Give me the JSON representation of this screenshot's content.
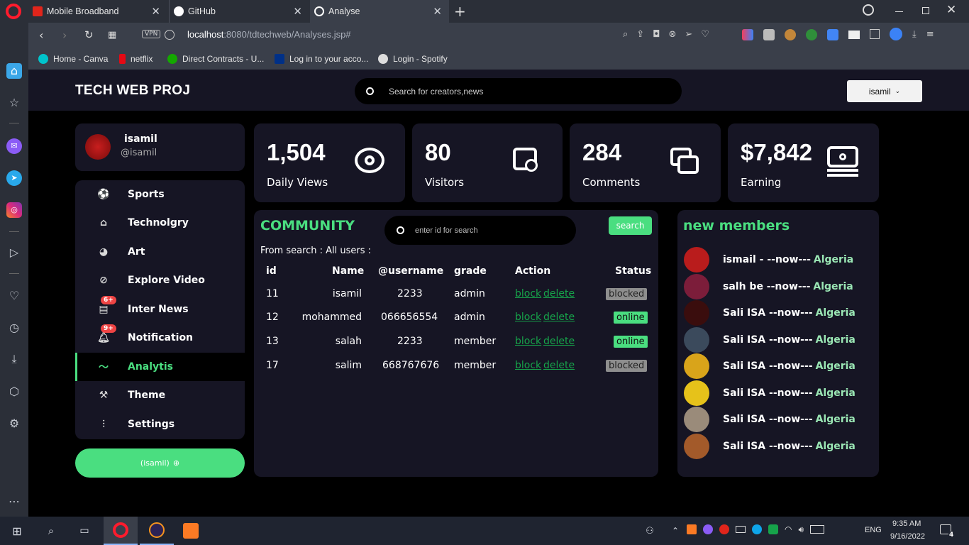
{
  "browser": {
    "tabs": [
      {
        "label": "Mobile Broadband",
        "favicon": "huawei-icon",
        "color": "#e1251b"
      },
      {
        "label": "GitHub",
        "favicon": "github-icon",
        "color": "#ffffff"
      },
      {
        "label": "Analyse",
        "favicon": "globe-icon",
        "color": "#ffffff"
      }
    ],
    "url_host": "localhost",
    "url_rest": ":8080/tdtechweb/Analyses.jsp#",
    "vpn_label": "VPN",
    "bookmarks": [
      {
        "label": "Home - Canva",
        "color": "#00c4cc"
      },
      {
        "label": "netflix",
        "color": "#e50914"
      },
      {
        "label": "Direct Contracts - U...",
        "color": "#14a800"
      },
      {
        "label": "Log in to your acco...",
        "color": "#003087"
      },
      {
        "label": "Login - Spotify",
        "color": "#1db954"
      }
    ]
  },
  "app": {
    "logo": "TECH WEB PROJ",
    "search_placeholder": "Search for creators,news",
    "user_menu": "isamil",
    "accent": "#4ade80"
  },
  "profile": {
    "name": "isamil",
    "handle": "@isamil"
  },
  "menu": [
    {
      "label": "Sports",
      "icon": "ball-icon",
      "badge": ""
    },
    {
      "label": "Technolgry",
      "icon": "robot-icon",
      "badge": ""
    },
    {
      "label": "Art",
      "icon": "palette-icon",
      "badge": ""
    },
    {
      "label": "Explore Video",
      "icon": "compass-icon",
      "badge": ""
    },
    {
      "label": "Inter News",
      "icon": "newspaper-icon",
      "badge": "6+"
    },
    {
      "label": "Notification",
      "icon": "bell-icon",
      "badge": "9+"
    },
    {
      "label": "Analytis",
      "icon": "trend-icon",
      "badge": ""
    },
    {
      "label": "Theme",
      "icon": "paint-roller-icon",
      "badge": ""
    },
    {
      "label": "Settings",
      "icon": "sliders-icon",
      "badge": ""
    }
  ],
  "logout_button": "(isamil)",
  "stats": [
    {
      "value": "1,504",
      "label": "Daily Views",
      "icon": "eye-icon"
    },
    {
      "value": "80",
      "label": "Visitors",
      "icon": "search-doc-icon"
    },
    {
      "value": "284",
      "label": "Comments",
      "icon": "chat-icon"
    },
    {
      "value": "$7,842",
      "label": "Earning",
      "icon": "money-icon"
    }
  ],
  "community": {
    "title": "COMMUNITY",
    "search_placeholder": "enter id for search",
    "search_button": "search",
    "filter_text": "From search : All users :",
    "headers": {
      "id": "id",
      "name": "Name",
      "username": "@username",
      "grade": "grade",
      "action": "Action",
      "status": "Status"
    },
    "rows": [
      {
        "id": "11",
        "name": "isamil",
        "username": "2233",
        "grade": "admin",
        "block": "block",
        "delete": "delete",
        "status": "blocked"
      },
      {
        "id": "12",
        "name": "mohammed",
        "username": "066656554",
        "grade": "admin",
        "block": "block",
        "delete": "delete",
        "status": "online"
      },
      {
        "id": "13",
        "name": "salah",
        "username": "2233",
        "grade": "member",
        "block": "block",
        "delete": "delete",
        "status": "online"
      },
      {
        "id": "17",
        "name": "salim",
        "username": "668767676",
        "grade": "member",
        "block": "block",
        "delete": "delete",
        "status": "blocked"
      }
    ]
  },
  "new_members": {
    "title": "new members",
    "items": [
      {
        "name": "ismail - --now---",
        "country": "Algeria",
        "avatar_color": "#b91c1c"
      },
      {
        "name": "salh be --now---",
        "country": "Algeria",
        "avatar_color": "#7c1d3a"
      },
      {
        "name": "Sali ISA --now---",
        "country": "Algeria",
        "avatar_color": "#3a0d0d"
      },
      {
        "name": "Sali ISA --now---",
        "country": "Algeria",
        "avatar_color": "#3b4a5c"
      },
      {
        "name": "Sali ISA --now---",
        "country": "Algeria",
        "avatar_color": "#d9a41a"
      },
      {
        "name": "Sali ISA --now---",
        "country": "Algeria",
        "avatar_color": "#e6c21a"
      },
      {
        "name": "Sali ISA --now---",
        "country": "Algeria",
        "avatar_color": "#9a8b7a"
      },
      {
        "name": "Sali ISA --now---",
        "country": "Algeria",
        "avatar_color": "#a35a2a"
      }
    ]
  },
  "taskbar": {
    "lang": "ENG",
    "time": "9:35 AM",
    "date": "9/16/2022",
    "notifications": "4"
  }
}
